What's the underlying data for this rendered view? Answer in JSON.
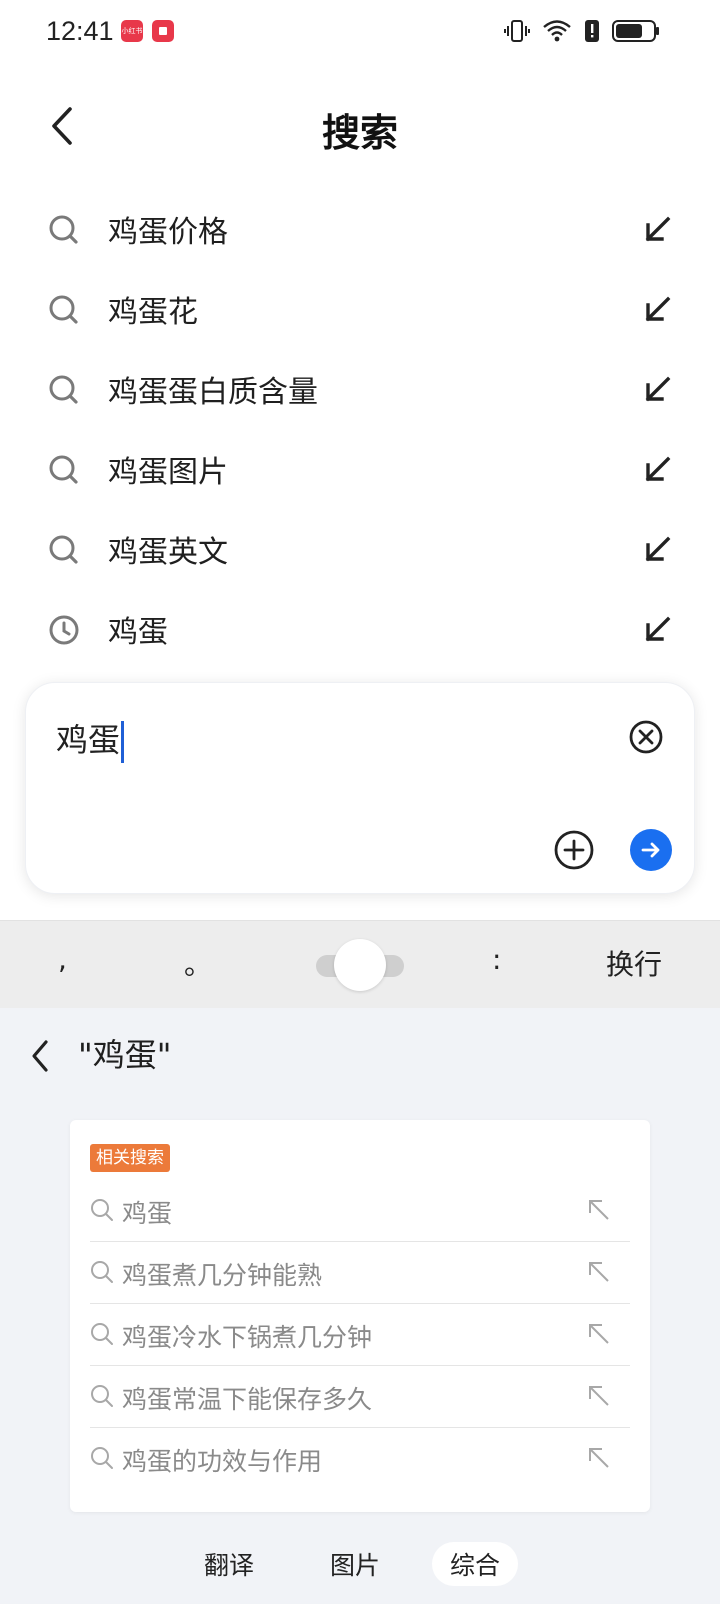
{
  "status_bar": {
    "time": "12:41",
    "notif_icons": [
      {
        "icon": "app-badge-icon",
        "text": "小红书"
      },
      {
        "icon": "app-square-icon",
        "text": ""
      }
    ],
    "right_icons": [
      "vibrate-icon",
      "wifi-icon",
      "alert-icon",
      "battery-icon"
    ]
  },
  "header": {
    "title": "搜索"
  },
  "suggestions": [
    {
      "label": "鸡蛋价格",
      "type": "search"
    },
    {
      "label": "鸡蛋花",
      "type": "search"
    },
    {
      "label": "鸡蛋蛋白质含量",
      "type": "search"
    },
    {
      "label": "鸡蛋图片",
      "type": "search"
    },
    {
      "label": "鸡蛋英文",
      "type": "search"
    },
    {
      "label": "鸡蛋",
      "type": "history"
    }
  ],
  "input": {
    "value": "鸡蛋"
  },
  "keyboard_strip": {
    "keys": [
      ",",
      "。",
      ":",
      "换行"
    ]
  },
  "prediction": {
    "query": "\"鸡蛋\"",
    "tag": "相关搜索",
    "items": [
      "鸡蛋",
      "鸡蛋煮几分钟能熟",
      "鸡蛋冷水下锅煮几分钟",
      "鸡蛋常温下能保存多久",
      "鸡蛋的功效与作用"
    ],
    "tabs": [
      "翻译",
      "图片",
      "综合"
    ],
    "active_tab": "综合"
  },
  "colors": {
    "accent": "#1a6ff0",
    "tag": "#ec7a3a",
    "caret": "#1f5fd6"
  }
}
